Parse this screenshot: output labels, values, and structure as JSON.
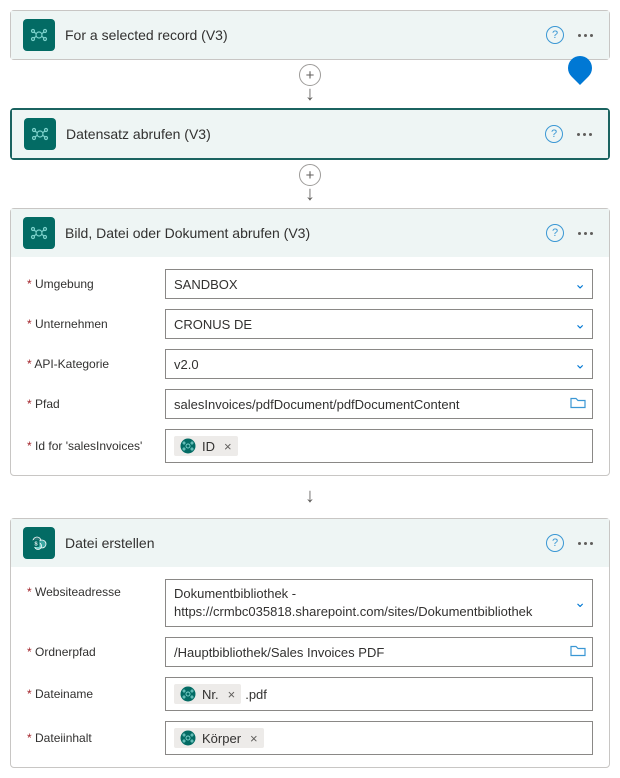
{
  "steps": [
    {
      "title": "For a selected record (V3)"
    },
    {
      "title": "Datensatz abrufen (V3)"
    },
    {
      "title": "Bild, Datei oder Dokument abrufen (V3)",
      "fields": {
        "env_label": "Umgebung",
        "env_value": "SANDBOX",
        "company_label": "Unternehmen",
        "company_value": "CRONUS DE",
        "apicat_label": "API-Kategorie",
        "apicat_value": "v2.0",
        "path_label": "Pfad",
        "path_value": "salesInvoices/pdfDocument/pdfDocumentContent",
        "id_label": "Id for 'salesInvoices'",
        "id_token": "ID"
      }
    },
    {
      "title": "Datei erstellen",
      "fields": {
        "site_label": "Websiteadresse",
        "site_value_l1": "Dokumentbibliothek - ",
        "site_value_l2": "https://crmbc035818.sharepoint.com/sites/Dokumentbibliothek",
        "folder_label": "Ordnerpfad",
        "folder_value": "/Hauptbibliothek/Sales Invoices PDF",
        "fname_label": "Dateiname",
        "fname_token": "Nr.",
        "fname_suffix": ".pdf",
        "content_label": "Dateiinhalt",
        "content_token": "Körper"
      }
    }
  ]
}
